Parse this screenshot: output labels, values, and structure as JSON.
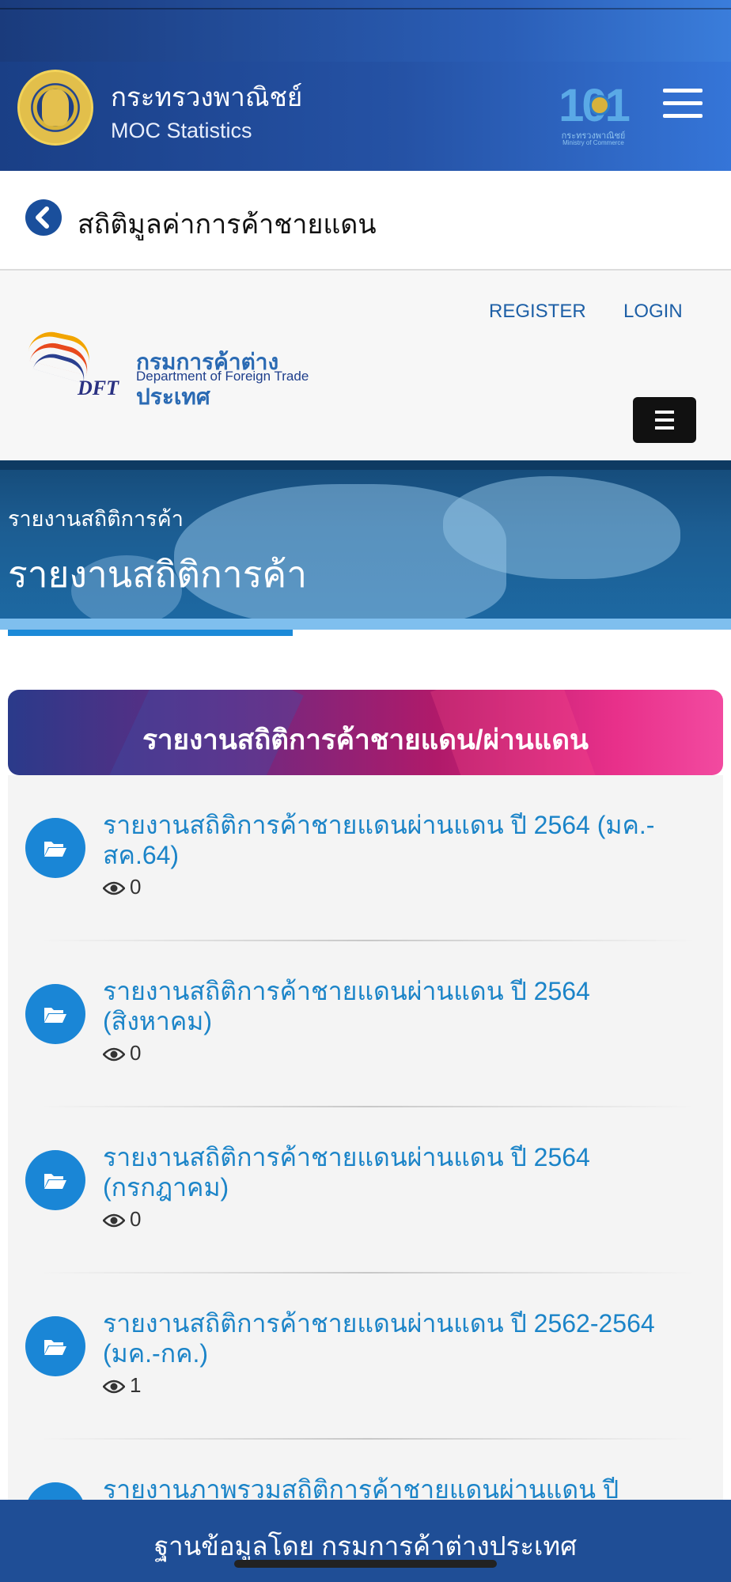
{
  "app_header": {
    "ministry_name": "กระทรวงพาณิชย์",
    "ministry_subtitle": "MOC Statistics",
    "anniversary_logo": {
      "number": "101",
      "caption": "กระทรวงพาณิชย์",
      "caption_en": "Ministry of Commerce"
    },
    "menu_icon": "hamburger-icon",
    "colors": {
      "background": "#2552a5",
      "accent": "#3575d8"
    }
  },
  "page_title_bar": {
    "back_icon": "chevron-left-icon",
    "title": "สถิติมูลค่าการค้าชายแดน"
  },
  "site_header": {
    "register_label": "REGISTER",
    "login_label": "LOGIN",
    "dft_logo": {
      "abbreviation": "DFT",
      "name_th": "กรมการค้าต่างประเทศ",
      "name_en": "Department of Foreign Trade"
    },
    "menu_icon": "bars-icon"
  },
  "banner": {
    "breadcrumb": "รายงานสถิติการค้า",
    "title": "รายงานสถิติการค้า"
  },
  "report_card": {
    "title": "รายงานสถิติการค้าชายแดน/ผ่านแดน",
    "item_icon": "folder-open-icon",
    "views_icon": "eye-icon",
    "items": [
      {
        "title": "รายงานสถิติการค้าชายแดนผ่านแดน ปี 2564 (มค.-สค.64)",
        "views": "0"
      },
      {
        "title": "รายงานสถิติการค้าชายแดนผ่านแดน ปี 2564 (สิงหาคม)",
        "views": "0"
      },
      {
        "title": "รายงานสถิติการค้าชายแดนผ่านแดน ปี 2564 (กรกฎาคม)",
        "views": "0"
      },
      {
        "title": "รายงานสถิติการค้าชายแดนผ่านแดน ปี 2562-2564 (มค.-กค.)",
        "views": "1"
      },
      {
        "title": "รายงานภาพรวมสถิติการค้าชายแดนผ่านแดน ปี",
        "views": ""
      }
    ]
  },
  "footer": {
    "text": "ฐานข้อมูลโดย กรมการค้าต่างประเทศ"
  }
}
